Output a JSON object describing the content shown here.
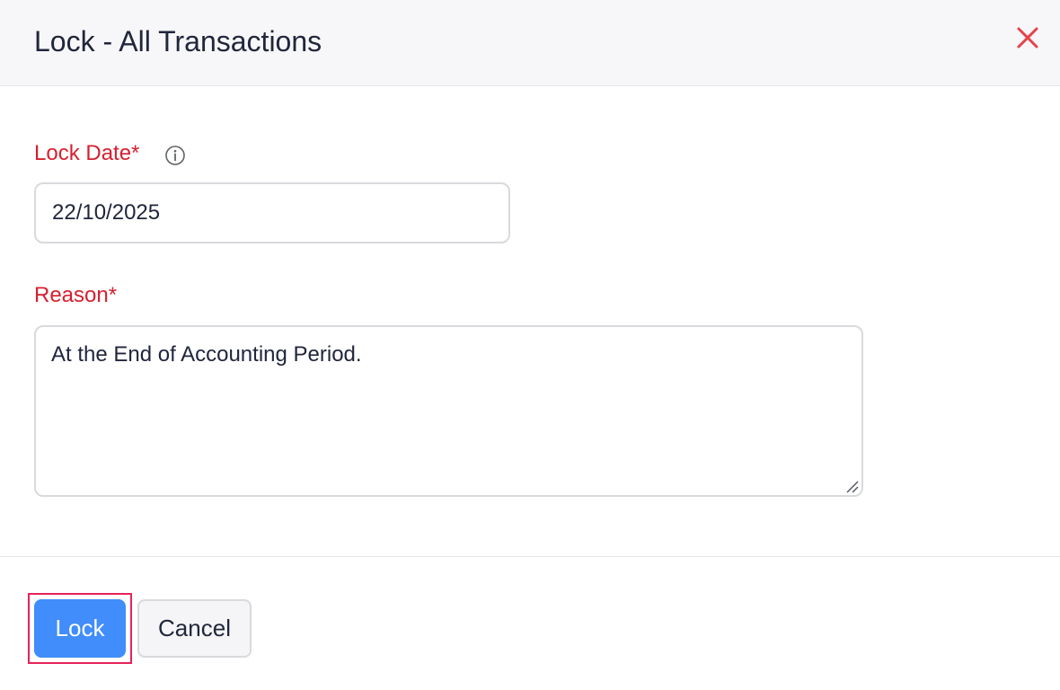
{
  "dialog": {
    "title": "Lock - All Transactions",
    "close_icon": "close-icon"
  },
  "form": {
    "lock_date": {
      "label": "Lock Date*",
      "info_icon": "info-icon",
      "value": "22/10/2025"
    },
    "reason": {
      "label": "Reason*",
      "value": "At the End of Accounting Period."
    }
  },
  "footer": {
    "lock_label": "Lock",
    "cancel_label": "Cancel"
  },
  "colors": {
    "required_label": "#d6202f",
    "primary_button": "#408dfb",
    "close_icon": "#e5434a",
    "focus_ring": "#e8225a"
  }
}
